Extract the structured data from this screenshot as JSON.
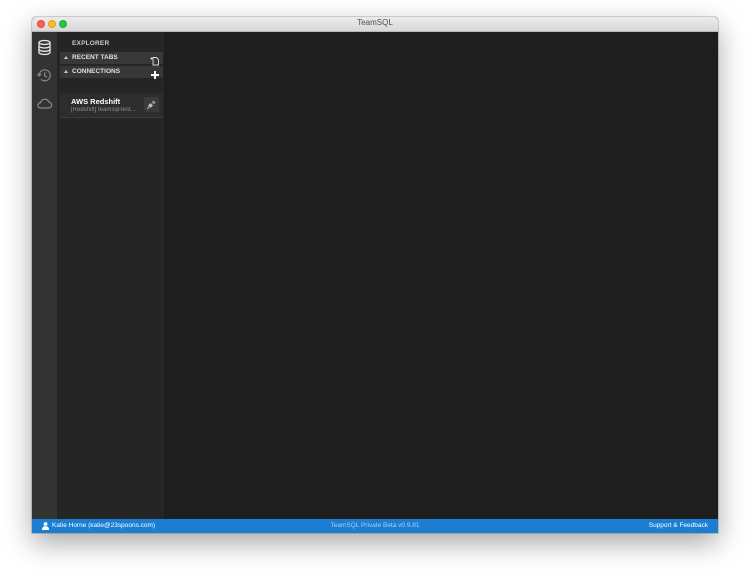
{
  "window": {
    "title": "TeamSQL"
  },
  "activity_bar": {
    "icons": [
      "database-icon",
      "history-icon",
      "cloud-icon"
    ]
  },
  "sidebar": {
    "title": "EXPLORER",
    "recent_tabs": {
      "label": "RECENT TABS",
      "action_icon": "new-tab-icon"
    },
    "connections": {
      "label": "CONNECTIONS",
      "action_icon": "plus-icon",
      "items": [
        {
          "name": "AWS Redshift",
          "detail": "[Redshift] teamsql-test...",
          "action_icon": "plug-connect-icon"
        }
      ]
    }
  },
  "status_bar": {
    "user": "Katie Horne (katie@23spoons.com)",
    "version": "TeamSQL Private Beta v0.9.81",
    "support": "Support & Feedback"
  },
  "colors": {
    "accent": "#1b7ed3",
    "sidebar_bg": "#252526",
    "editor_bg": "#1e1e1e",
    "activity_bar_bg": "#333333"
  }
}
